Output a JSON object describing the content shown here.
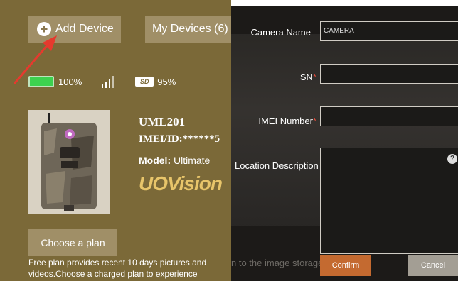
{
  "toolbar": {
    "add_label": "Add Device",
    "my_devices_label": "My Devices (6)"
  },
  "status": {
    "battery": "100%",
    "battery_level": 1.0,
    "storage": "95%",
    "storage_level": 0.95,
    "sd_label": "SD"
  },
  "device": {
    "name": "UML201",
    "imei": "IMEI/ID:******5",
    "model_label": "Model:",
    "model_value": "Ultimate",
    "logo_text": "UOVision"
  },
  "plan": {
    "button": "Choose a plan",
    "text": "Free plan provides recent 10 days pictures and videos.Choose a charged plan to experience"
  },
  "dialog": {
    "camera_name_label": "Camera Name",
    "camera_name_value": "CAMERA",
    "sn_label": "SN",
    "imei_label": "IMEI Number",
    "location_label": "Location Description",
    "required_mark": "*",
    "help_icon": "?",
    "confirm": "Confirm",
    "cancel": "Cancel",
    "background_text": "n to the image storage,"
  },
  "colors": {
    "panel": "#7b6938",
    "button": "#a08f67",
    "confirm": "#c46a30",
    "cancel": "#a39e94",
    "arrow": "#e53a2e"
  }
}
